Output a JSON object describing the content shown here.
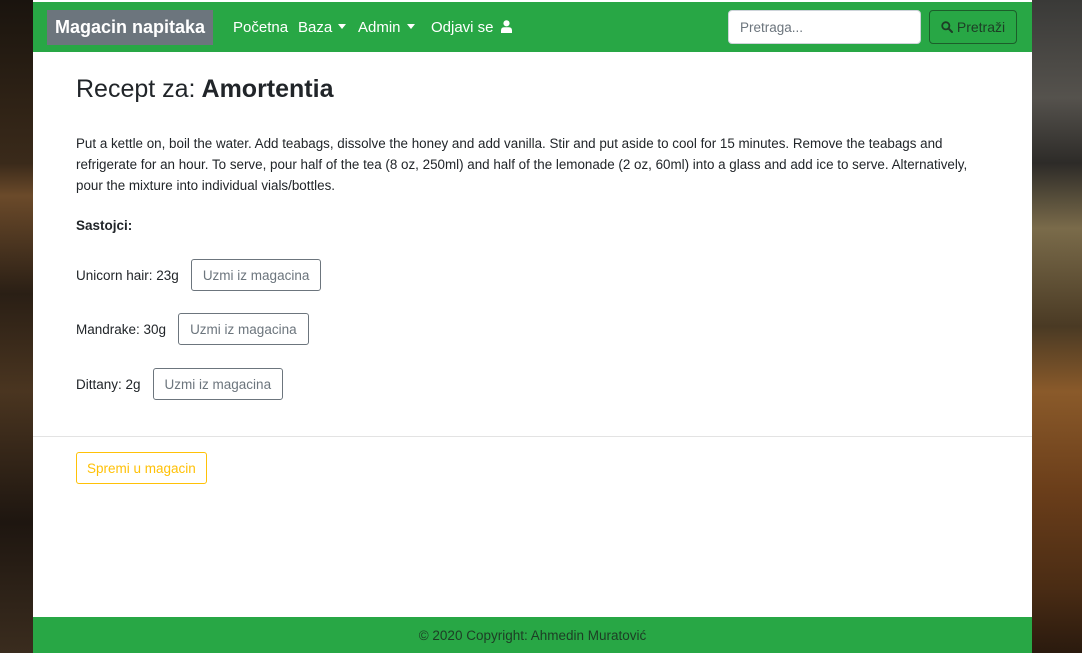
{
  "navbar": {
    "brand": "Magacin napitaka",
    "items": [
      {
        "label": "Početna"
      },
      {
        "label": "Baza"
      },
      {
        "label": "Admin"
      },
      {
        "label": "Odjavi se"
      }
    ],
    "search": {
      "placeholder": "Pretraga...",
      "value": ""
    },
    "search_button_label": "Pretraži",
    "color": "#28a745"
  },
  "recipe": {
    "title_prefix": "Recept za:",
    "name": "Amortentia",
    "description": "Put a kettle on, boil the water. Add teabags, dissolve the honey and add vanilla. Stir and put aside to cool for 15 minutes. Remove the teabags and refrigerate for an hour. To serve, pour half of the tea (8 oz, 250ml) and half of the lemonade (2 oz, 60ml) into a glass and add ice to serve. Alternatively, pour the mixture into individual vials/bottles.",
    "ingredients_heading": "Sastojci:",
    "ingredients": [
      {
        "label": "Unicorn hair: 23g",
        "button": "Uzmi iz magacina"
      },
      {
        "label": "Mandrake: 30g",
        "button": "Uzmi iz magacina"
      },
      {
        "label": "Dittany: 2g",
        "button": "Uzmi iz magacina"
      }
    ]
  },
  "save_button_label": "Spremi u magacin",
  "footer": {
    "text": "© 2020 Copyright: Ahmedin Muratović"
  },
  "colors": {
    "primary": "#28a745",
    "warning": "#ffc107",
    "secondary": "#6c757d"
  }
}
